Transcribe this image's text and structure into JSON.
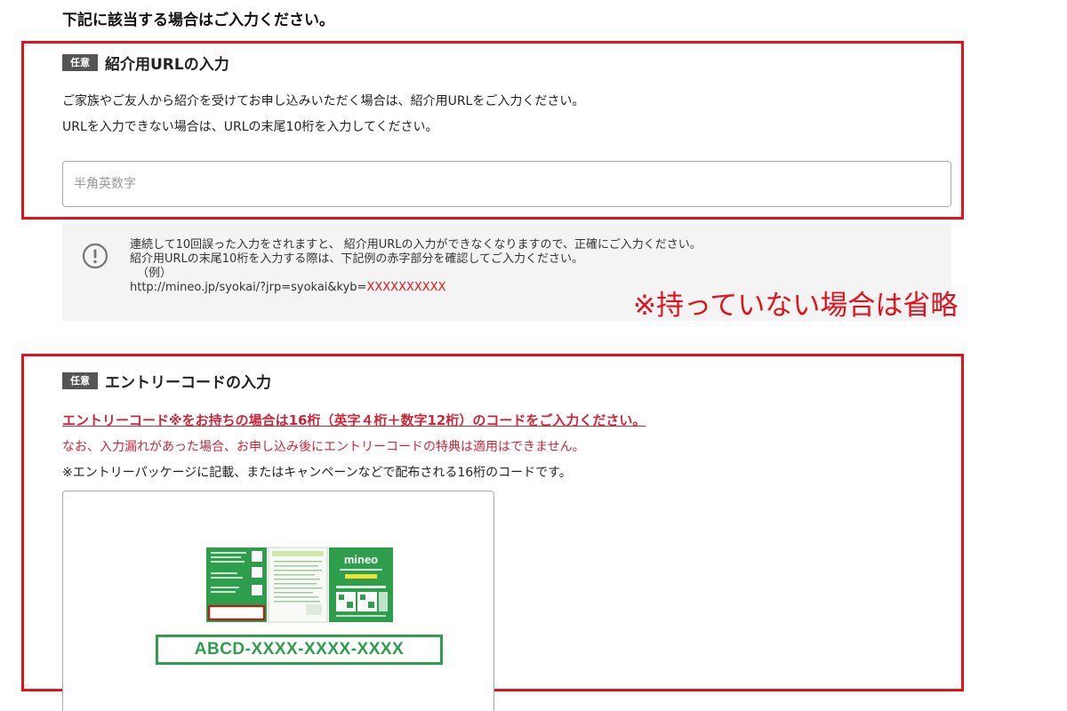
{
  "heading": "下記に該当する場合はご入力ください。",
  "referral": {
    "badge": "任意",
    "title": "紹介用URLの入力",
    "desc_line1": "ご家族やご友人から紹介を受けてお申し込みいただく場合は、紹介用URLをご入力ください。",
    "desc_line2": "URLを入力できない場合は、URLの末尾10桁を入力してください。",
    "input_value": "",
    "input_placeholder": "半角英数字",
    "notice": {
      "line1": "連続して10回誤った入力をされますと、 紹介用URLの入力ができなくなりますので、正確にご入力ください。",
      "line2": "紹介用URLの末尾10桁を入力する際は、下記例の赤字部分を確認してご入力ください。",
      "line3": "（例）",
      "url_prefix": "http://mineo.jp/syokai/?jrp=syokai&kyb=",
      "url_highlight": "XXXXXXXXXX",
      "icon": "exclamation-circle-icon"
    }
  },
  "annotation": "※持っていない場合は省略",
  "entry": {
    "badge": "任意",
    "title": "エントリーコードの入力",
    "warn_link": "エントリーコード※をお持ちの場合は16桁（英字４桁＋数字12桁）のコードをご入力ください。",
    "warn_line": "なお、入力漏れがあった場合、お申し込み後にエントリーコードの特典は適用はできません。",
    "note": "※エントリーパッケージに記載、またはキャンペーンなどで配布される16桁のコードです。",
    "package": {
      "brand": "mineo"
    },
    "code_example": "ABCD-XXXX-XXXX-XXXX"
  },
  "colors": {
    "annotation_red": "#e0121b",
    "warning_red": "#c8283a",
    "package_green": "#2e9e4d",
    "badge_gray": "#555555"
  }
}
